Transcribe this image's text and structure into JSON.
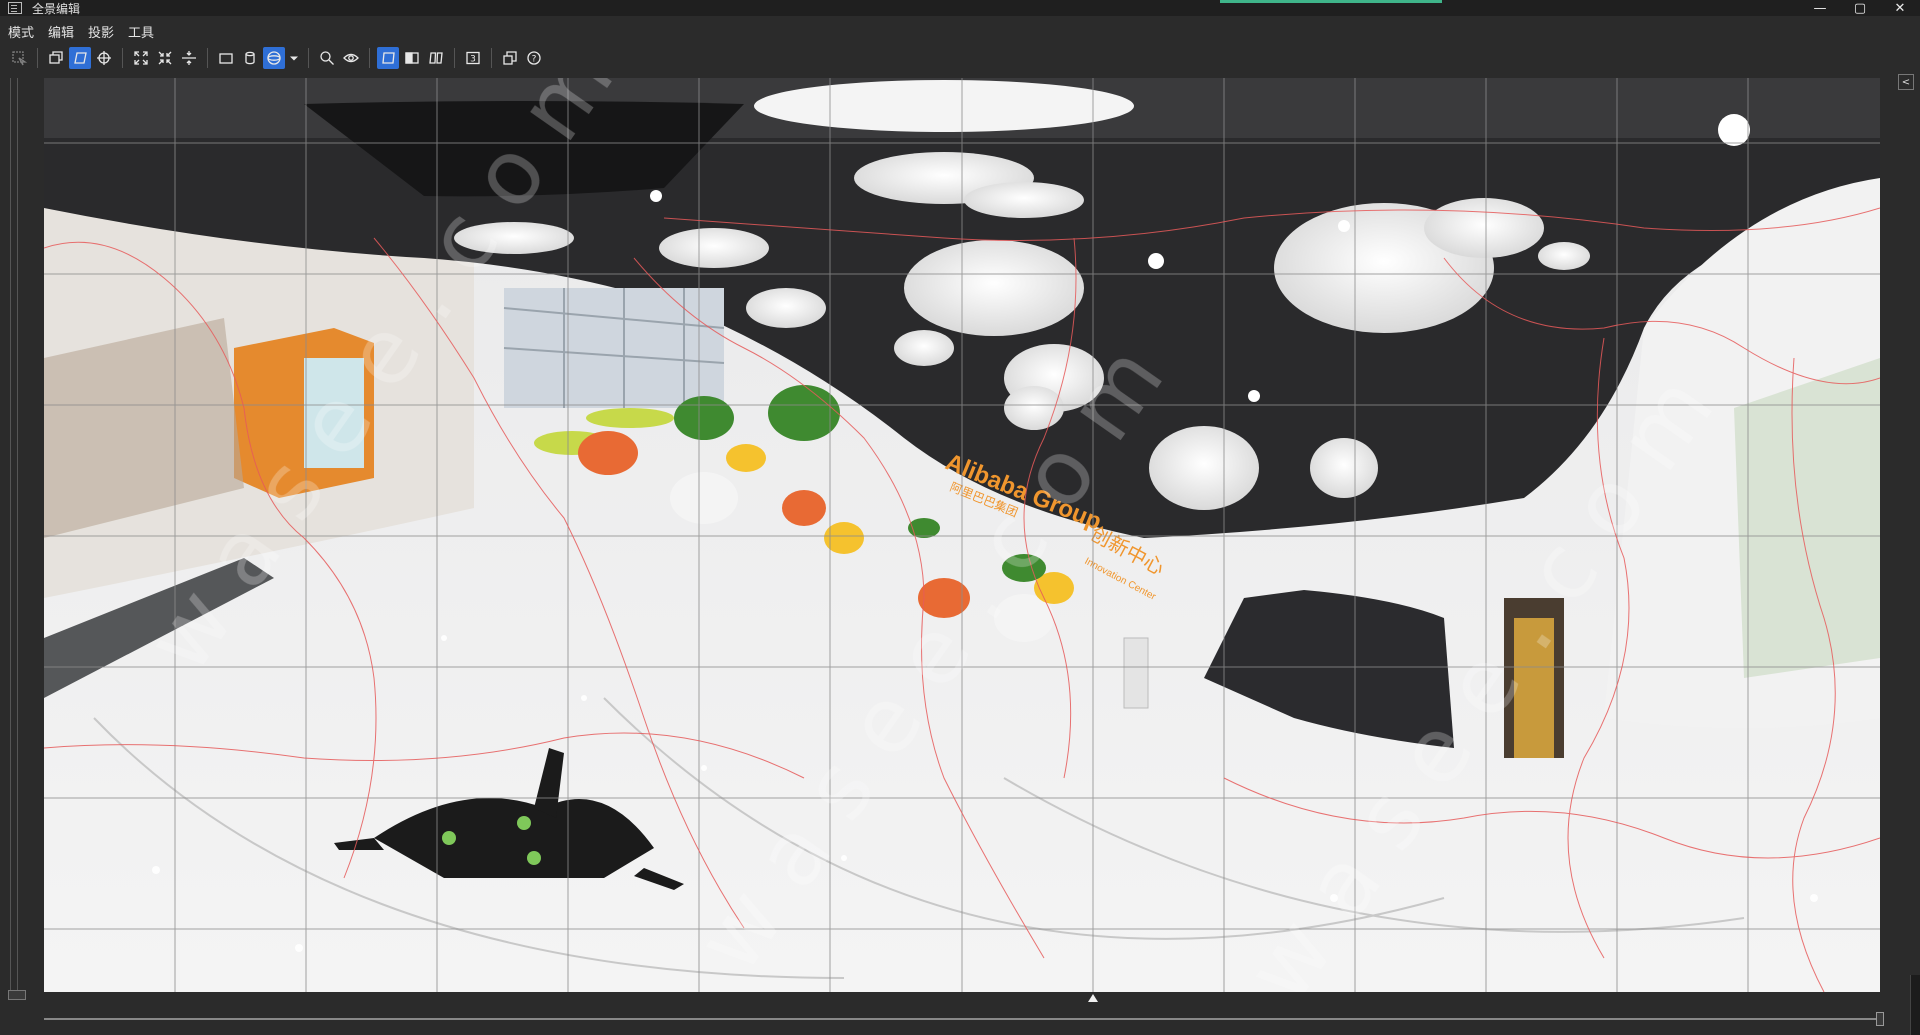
{
  "window": {
    "title": "全景编辑",
    "minimize": "—",
    "maximize": "▢",
    "close": "✕"
  },
  "menu": {
    "items": [
      "模式",
      "编辑",
      "投影",
      "工具"
    ]
  },
  "toolbar": {
    "badge_number": "3",
    "help": "?"
  },
  "canvas": {
    "watermark": "w a s e e . c o m",
    "sign_brand": "Alibaba Group",
    "sign_brand_cn": "阿里巴巴集团",
    "sign_center_cn": "创新中心",
    "sign_center_en": "Innovation Center",
    "grid_columns": 14,
    "grid_rows": 7
  },
  "side": {
    "collapse_label": "<"
  },
  "colors": {
    "active_tool": "#2f6fd6",
    "grid_line": "#8c8c8c",
    "seam_line": "#e65a5a",
    "title_accent": "#3fb58a"
  }
}
